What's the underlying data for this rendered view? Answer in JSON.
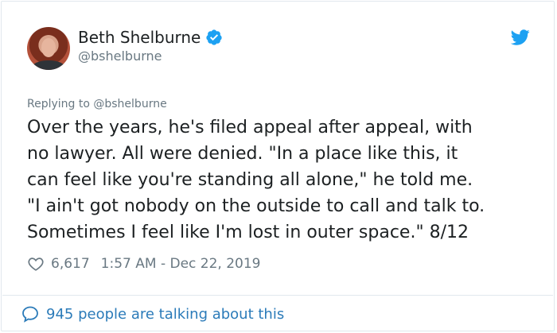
{
  "author": {
    "name": "Beth Shelburne",
    "handle": "@bshelburne"
  },
  "tweet": {
    "replying_to": "Replying to @bshelburne",
    "text": "Over the years, he's filed appeal after appeal, with\nno lawyer. All were denied. \"In a place like this, it\ncan feel like you're standing all alone,\" he told me.\n\"I ain't got nobody on the outside to call and talk to.\nSometimes I feel like I'm lost in outer space.\" 8/12",
    "likes": "6,617",
    "timestamp": "1:57 AM - Dec 22, 2019"
  },
  "footer": {
    "talking": "945 people are talking about this"
  },
  "colors": {
    "accent": "#1da1f2",
    "link": "#2b7bb9",
    "muted": "#697882",
    "border": "#e1e8ed"
  },
  "icons": [
    "verified-badge-icon",
    "twitter-bird-icon",
    "heart-icon",
    "speech-bubble-icon"
  ]
}
